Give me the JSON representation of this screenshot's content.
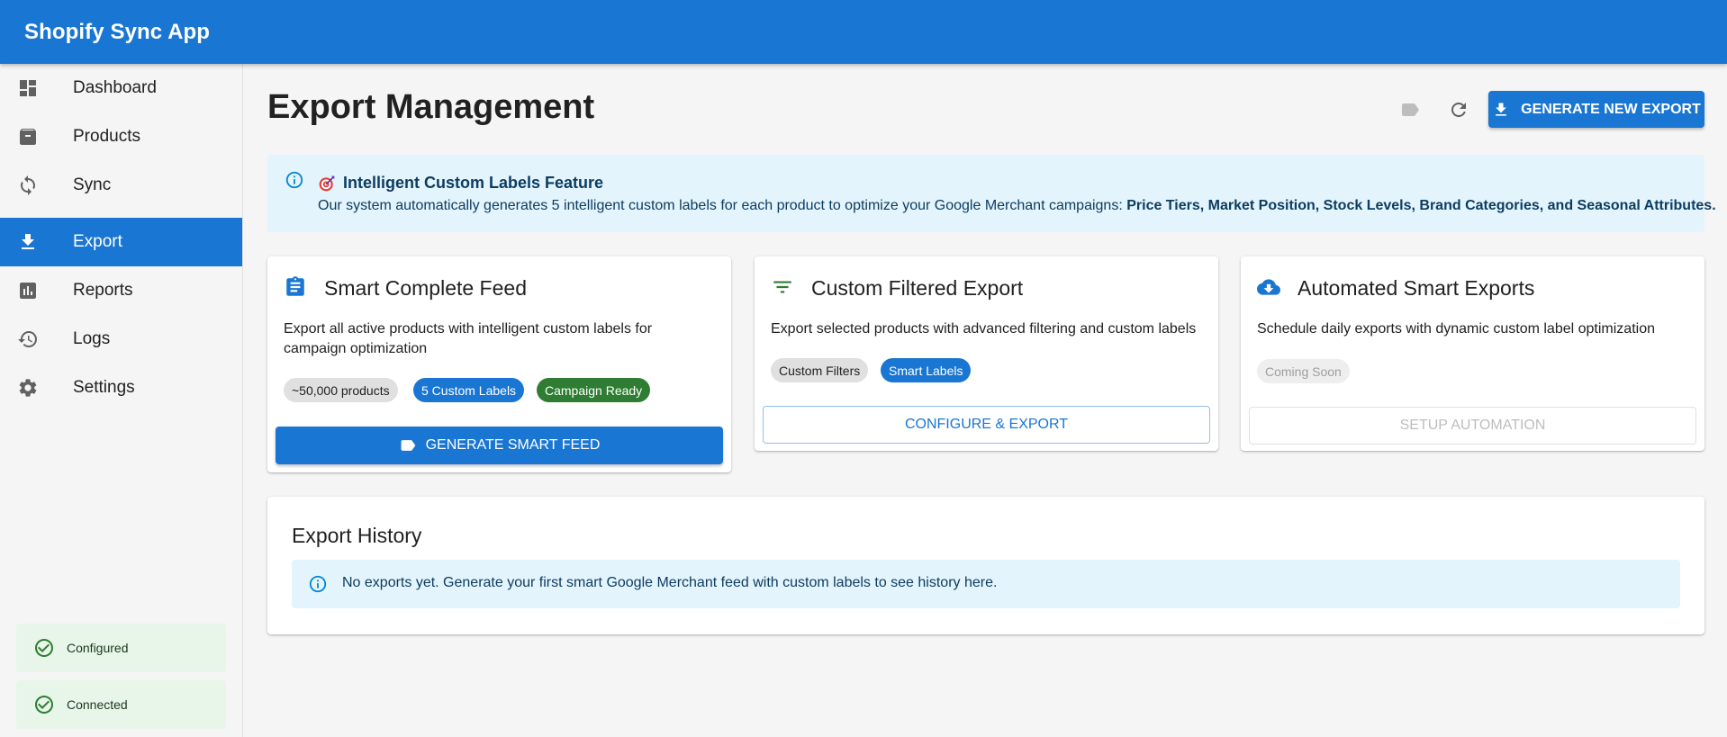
{
  "app": {
    "title": "Shopify Sync App"
  },
  "sidebar": {
    "items": [
      {
        "label": "Dashboard",
        "icon": "dashboard-icon",
        "active": false
      },
      {
        "label": "Products",
        "icon": "archive-icon",
        "active": false
      },
      {
        "label": "Sync",
        "icon": "sync-icon",
        "active": false
      },
      {
        "label": "Export",
        "icon": "download-icon",
        "active": true
      },
      {
        "label": "Reports",
        "icon": "assessment-icon",
        "active": false
      },
      {
        "label": "Logs",
        "icon": "history-icon",
        "active": false
      },
      {
        "label": "Settings",
        "icon": "gear-icon",
        "active": false
      }
    ],
    "status": [
      {
        "label": "Configured",
        "icon": "check-circle-icon"
      },
      {
        "label": "Connected",
        "icon": "check-circle-icon"
      }
    ]
  },
  "header": {
    "title": "Export Management",
    "generate_button": "GENERATE NEW EXPORT"
  },
  "banner": {
    "title": "Intelligent Custom Labels Feature",
    "body_prefix": "Our system automatically generates 5 intelligent custom labels for each product to optimize your Google Merchant campaigns: ",
    "body_bold": "Price Tiers, Market Position, Stock Levels, Brand Categories, and Seasonal Attributes."
  },
  "cards": [
    {
      "title": "Smart Complete Feed",
      "icon": "clipboard-icon",
      "description": "Export all active products with intelligent custom labels for campaign optimization",
      "chips": [
        "~50,000 products",
        "5 Custom Labels",
        "Campaign Ready"
      ],
      "button": "GENERATE SMART FEED"
    },
    {
      "title": "Custom Filtered Export",
      "icon": "filter-icon",
      "description": "Export selected products with advanced filtering and custom labels",
      "chips": [
        "Custom Filters",
        "Smart Labels"
      ],
      "button": "CONFIGURE & EXPORT"
    },
    {
      "title": "Automated Smart Exports",
      "icon": "cloud-download-icon",
      "description": "Schedule daily exports with dynamic custom label optimization",
      "chips": [
        "Coming Soon"
      ],
      "button": "SETUP AUTOMATION"
    }
  ],
  "history": {
    "title": "Export History",
    "empty_message": "No exports yet. Generate your first smart Google Merchant feed with custom labels to see history here."
  },
  "colors": {
    "primary": "#1976d2",
    "success": "#2e7d32",
    "info_bg": "#e3f4fc",
    "info_icon": "#0288d1"
  }
}
